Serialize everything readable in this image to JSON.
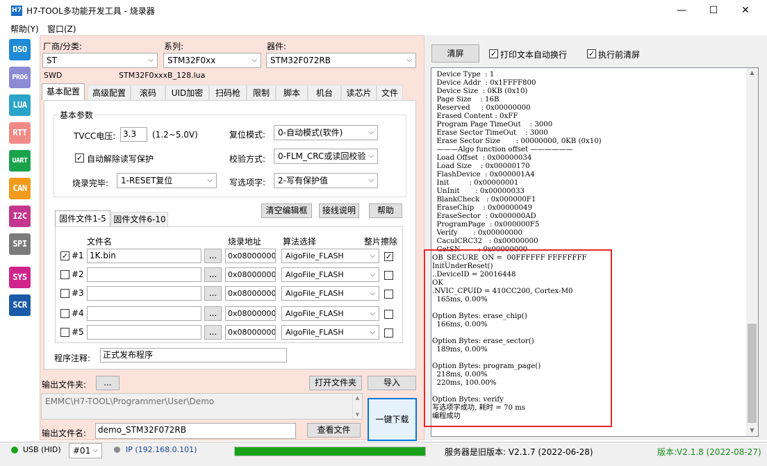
{
  "window": {
    "title": "H7-TOOL多功能开发工具 - 烧录器",
    "icon_text": "H7",
    "minimize": "—",
    "maximize": "☐",
    "close": "✕"
  },
  "menu": [
    "帮助(Y)",
    "窗口(Z)"
  ],
  "tools": [
    {
      "label": "DSO",
      "color": "#1f8bd8"
    },
    {
      "label": "PROG",
      "color": "#8d8ad4"
    },
    {
      "label": "LUA",
      "color": "#2aa4c9"
    },
    {
      "label": "RTT",
      "color": "#f08a86"
    },
    {
      "label": "UART",
      "color": "#1aa34a"
    },
    {
      "label": "CAN",
      "color": "#f29a1b"
    },
    {
      "label": "I2C",
      "color": "#c3378e"
    },
    {
      "label": "SPI",
      "color": "#7b7b7b"
    },
    {
      "label": "SYS",
      "color": "#d0248a"
    },
    {
      "label": "SCR",
      "color": "#1b5aa8"
    }
  ],
  "selectors": {
    "vendor_label": "厂商/分类:",
    "vendor_value": "ST",
    "series_label": "系列:",
    "series_value": "STM32F0xx",
    "device_label": "器件:",
    "device_value": "STM32F072RB"
  },
  "interface": "SWD",
  "lua_file": "STM32F0xxxB_128.lua",
  "tabs": [
    "基本配置",
    "高级配置",
    "滚码",
    "UID加密",
    "扫码枪",
    "限制",
    "脚本",
    "机台",
    "读芯片",
    "文件"
  ],
  "basic": {
    "group_title": "基本参数",
    "tvcc_label": "TVCC电压:",
    "tvcc_value": "3.3",
    "tvcc_range": "(1.2~5.0V)",
    "reset_label": "复位模式:",
    "reset_value": "0-自动模式(软件)",
    "unprotect_label": "自动解除读写保护",
    "unprotect_checked": "✓",
    "verify_label": "校验方式:",
    "verify_value": "0-FLM_CRC或读回校验",
    "done_label": "烧录完毕:",
    "done_value": "1-RESET复位",
    "option_label": "写选项字:",
    "option_value": "2-写有保护值"
  },
  "buttons": {
    "clear_editor": "清空编辑框",
    "wiring": "接线说明",
    "help": "帮助",
    "browse": "...",
    "open_folder": "打开文件夹",
    "import": "导入",
    "view_file": "查看文件",
    "one_click": "一键下载",
    "clear": "清屏"
  },
  "firmware": {
    "tab1": "固件文件1-5",
    "tab2": "固件文件6-10",
    "col_file": "文件名",
    "col_addr": "烧录地址",
    "col_algo": "算法选择",
    "col_erase": "整片擦除",
    "rows": [
      {
        "label": "#1",
        "checked": "✓",
        "file": "1K.bin",
        "addr": "0x08000000",
        "algo": "AlgoFile_FLASH",
        "erase": "✓"
      },
      {
        "label": "#2",
        "checked": "",
        "file": "",
        "addr": "0x08000000",
        "algo": "AlgoFile_FLASH",
        "erase": ""
      },
      {
        "label": "#3",
        "checked": "",
        "file": "",
        "addr": "0x08000000",
        "algo": "AlgoFile_FLASH",
        "erase": ""
      },
      {
        "label": "#4",
        "checked": "",
        "file": "",
        "addr": "0x08000000",
        "algo": "AlgoFile_FLASH",
        "erase": ""
      },
      {
        "label": "#5",
        "checked": "",
        "file": "",
        "addr": "0x08000000",
        "algo": "AlgoFile_FLASH",
        "erase": ""
      }
    ],
    "note_label": "程序注释:",
    "note_value": "正式发布程序"
  },
  "output": {
    "folder_label": "输出文件夹:",
    "folder_path": "EMMC\\H7-TOOL\\Programmer\\User\\Demo",
    "name_label": "输出文件名:",
    "name_value": "demo_STM32F072RB"
  },
  "right": {
    "wrap_label": "打印文本自动换行",
    "wrap_checked": "✓",
    "clear_before_label": "执行前清屏",
    "clear_before_checked": "✓"
  },
  "log": "  Device Type  : 1\n  Device Addr  : 0x1FFFF800\n  Device Size  : 0KB (0x10)\n  Page Size    : 16B\n  Reserved     : 0x00000000\n  Erased Content : 0xFF\n  Program Page TimeOut    : 3000\n  Erase Sector TimeOut    : 3000\n  Erase Sector Size       : 00000000, 0KB (0x10)\n  ———Algo function offset ——————\n  Load Offset  : 0x00000034\n  Load Size    : 0x00000170\n  FlashDevice  : 0x000001A4\n  Init         : 0x00000001\n  UnInit       : 0x00000033\n  BlankCheck   : 0x000000F1\n  EraseChip    : 0x00000049\n  EraseSector  : 0x000000AD\n  ProgramPage  : 0x000000F5\n  Verify       : 0x00000000\n  CaculCRC32   : 0x00000000\n  GetSN        : 0x00000000\nOB_SECURE_ON =  00FFFFFF FFFFFFFF\nInitUnderReset()\n..DeviceID = 20016448\nOK\n.NVIC_CPUID = 410CC200, Cortex-M0\n  165ms, 0.00%\n\nOption Bytes: erase_chip()\n  166ms, 0.00%\n\nOption Bytes: erase_sector()\n  189ms, 0.00%\n\nOption Bytes: program_page()\n  218ms, 0.00%\n  220ms, 100.00%\n\nOption Bytes: verify\n写选项字成功, 耗时 = 70 ms\n编程成功",
  "status": {
    "usb": "USB (HID)",
    "port": "#01",
    "ip": "IP (192.168.0.101)",
    "progress": 1.0,
    "server": "服务器是旧版本: V2.1.7 (2022-06-28)",
    "version": "版本:V2.1.8 (2022-08-27)"
  },
  "colors": {
    "highlight_box": "#e8262a",
    "progress": "#1aa31a",
    "version_text": "#1a8a1a"
  }
}
